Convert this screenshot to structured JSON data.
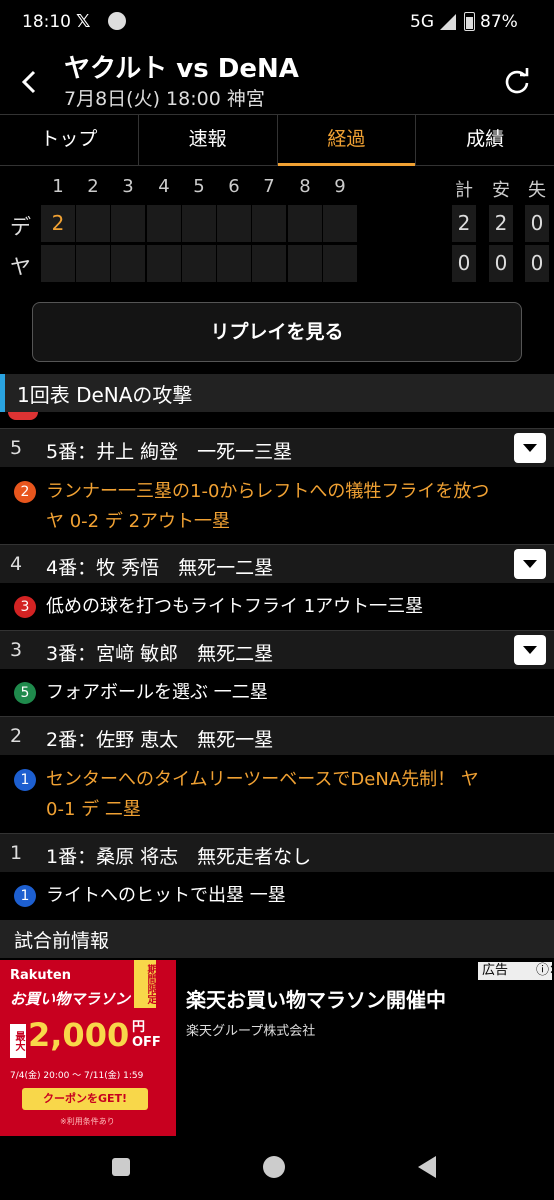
{
  "status_bar": {
    "time": "18:10",
    "x_glyph": "𝕏",
    "network": "5G",
    "battery": "87%"
  },
  "header": {
    "title": "ヤクルト vs DeNA",
    "subtitle": "7月8日(火) 18:00 神宮",
    "back_icon": "chevron-left",
    "refresh_icon": "refresh"
  },
  "tabs": [
    {
      "label": "トップ",
      "active": false
    },
    {
      "label": "速報",
      "active": false
    },
    {
      "label": "経過",
      "active": true
    },
    {
      "label": "成績",
      "active": false
    }
  ],
  "scoreboard": {
    "innings": [
      "1",
      "2",
      "3",
      "4",
      "5",
      "6",
      "7",
      "8",
      "9"
    ],
    "totals_header": [
      "計",
      "安",
      "失"
    ],
    "teams": [
      {
        "abbr": "デ",
        "innings": [
          "2",
          "",
          "",
          "",
          "",
          "",
          "",
          "",
          ""
        ],
        "totals": [
          "2",
          "2",
          "0"
        ]
      },
      {
        "abbr": "ヤ",
        "innings": [
          "",
          "",
          "",
          "",
          "",
          "",
          "",
          "",
          ""
        ],
        "totals": [
          "0",
          "0",
          "0"
        ]
      }
    ]
  },
  "replay_button": "リプレイを見る",
  "section_title": "1回表 DeNAの攻撃",
  "plays": {
    "b5": {
      "order": "5",
      "batter": "5番：井上 絢登　一死一三塁"
    },
    "p5": {
      "num": "2",
      "line1": "ランナー一三塁の1-0からレフトへの犠牲フライを放つ",
      "line2": "ヤ 0-2 デ 2アウト一塁"
    },
    "b4": {
      "order": "4",
      "batter": "4番：牧 秀悟　無死一二塁"
    },
    "p4": {
      "num": "3",
      "line1": "低めの球を打つもライトフライ 1アウト一三塁"
    },
    "b3": {
      "order": "3",
      "batter": "3番：宮﨑 敏郎　無死二塁"
    },
    "p3": {
      "num": "5",
      "line1": "フォアボールを選ぶ 一二塁"
    },
    "b2": {
      "order": "2",
      "batter": "2番：佐野 恵太　無死一塁"
    },
    "p2": {
      "num": "1",
      "line1": "センターへのタイムリーツーベースでDeNA先制！ ヤ",
      "line2": "0-1 デ 二塁"
    },
    "b1": {
      "order": "1",
      "batter": "1番：桑原 将志　無死走者なし"
    },
    "p1": {
      "num": "1",
      "line1": "ライトへのヒットで出塁 一塁"
    }
  },
  "pregame": "試合前情報",
  "ad": {
    "brand": "Rakuten",
    "marathon": "お買い物マラソン",
    "limited": "期間限定",
    "max": "最大",
    "amount": "2,000",
    "unit1": "円",
    "unit2": "OFF",
    "dates": "7/4(金) 20:00 ～ 7/11(金) 1:59",
    "coupon": "クーポンをGET!",
    "note": "※利用条件あり",
    "title": "楽天お買い物マラソン開催中",
    "corp": "楽天グループ株式会社",
    "badge": "広告",
    "badge_close": "ⓘ✕"
  },
  "colors": {
    "accent": "#f0a133",
    "section_bar": "#2aa3e0",
    "ad_red": "#c8001f",
    "circle_orange": "#e8561d",
    "circle_red": "#d32323",
    "circle_green": "#1f8a4c",
    "circle_blue": "#1d5fd0"
  }
}
